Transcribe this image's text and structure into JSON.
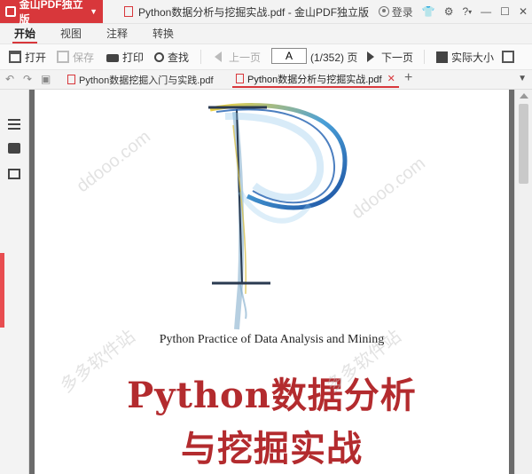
{
  "app": {
    "name": "金山PDF独立版",
    "window_title": "Python数据分析与挖掘实战.pdf - 金山PDF独立版"
  },
  "titlebar": {
    "login": "登录",
    "help": "?"
  },
  "menu": {
    "tabs": [
      "开始",
      "视图",
      "注释",
      "转换"
    ],
    "active": "开始"
  },
  "toolbar": {
    "open": "打开",
    "save": "保存",
    "print": "打印",
    "find": "查找",
    "prev": "上一页",
    "page_value": "A",
    "page_total": "(1/352) 页",
    "next": "下一页",
    "actual_size": "实际大小"
  },
  "tabs": [
    {
      "label": "Python数据挖掘入门与实践.pdf",
      "active": false
    },
    {
      "label": "Python数据分析与挖掘实战.pdf",
      "active": true
    }
  ],
  "document": {
    "subtitle": "Python Practice of Data Analysis and Mining",
    "title_line1": "Python数据分析",
    "title_line2": "与挖掘实战"
  },
  "watermark": {
    "text1": "ddooo.com",
    "text2": "多多软件站"
  },
  "colors": {
    "brand_red": "#d8373b",
    "title_red": "#b32b2e",
    "gray_bg": "#6b6b6b"
  }
}
